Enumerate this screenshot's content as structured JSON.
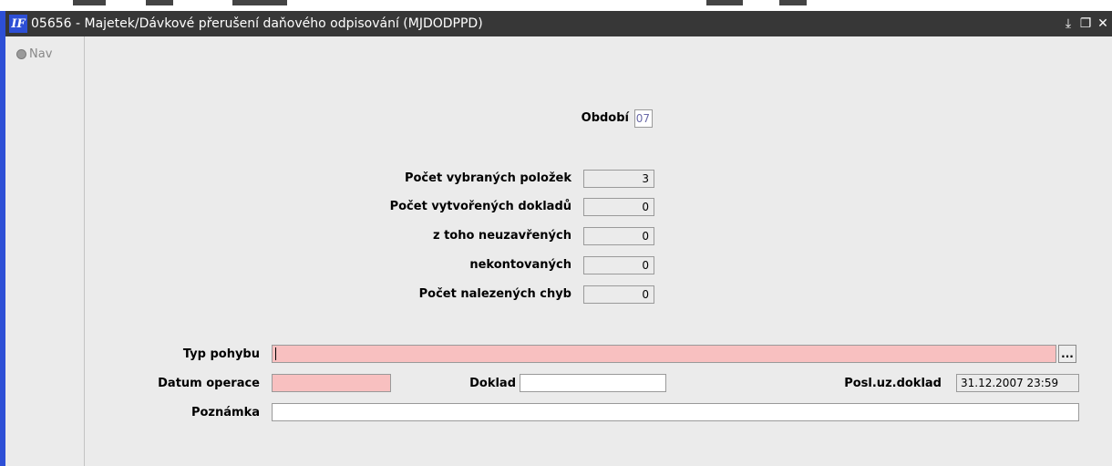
{
  "window": {
    "title": "05656 - Majetek/Dávkové přerušení daňového odpisování (MJDODPPD)",
    "logo_text": "IF",
    "controls": {
      "minimize": "⤓",
      "restore": "❐",
      "close": "✕"
    }
  },
  "nav": {
    "label": "Nav"
  },
  "period": {
    "label": "Období",
    "value": "07"
  },
  "stats": [
    {
      "label": "Počet vybraných položek",
      "value": "3"
    },
    {
      "label": "Počet vytvořených dokladů",
      "value": "0"
    },
    {
      "label": "z toho  neuzavřených",
      "value": "0"
    },
    {
      "label": "nekontovaných",
      "value": "0"
    },
    {
      "label": "Počet nalezených chyb",
      "value": "0"
    }
  ],
  "form": {
    "typ_pohybu": {
      "label": "Typ pohybu",
      "value": "",
      "lookup": "..."
    },
    "datum_operace": {
      "label": "Datum operace",
      "value": ""
    },
    "doklad": {
      "label": "Doklad",
      "value": ""
    },
    "posl_uz_doklad": {
      "label": "Posl.uz.doklad",
      "value": "31.12.2007 23:59"
    },
    "poznamka": {
      "label": "Poznámka",
      "value": ""
    }
  },
  "colors": {
    "titlebar": "#373737",
    "required_field": "#f8c0c0",
    "accent": "#2d4fd6"
  }
}
